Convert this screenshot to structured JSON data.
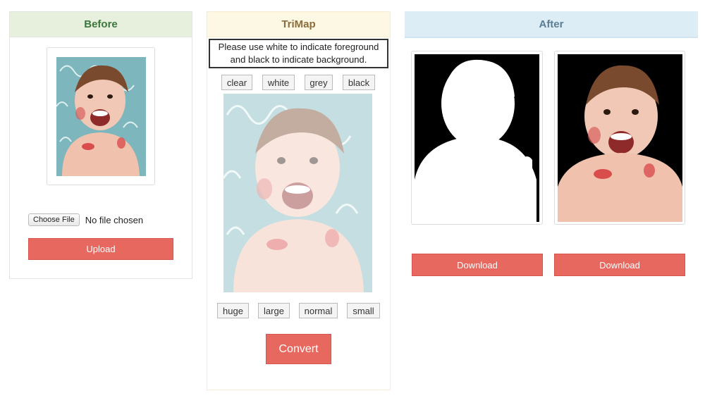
{
  "before": {
    "title": "Before",
    "choose_file_label": "Choose File",
    "file_status": "No file chosen",
    "upload_label": "Upload"
  },
  "trimap": {
    "title": "TriMap",
    "hint": "Please use white to indicate foreground and black to indicate background.",
    "colors": [
      "clear",
      "white",
      "grey",
      "black"
    ],
    "sizes": [
      "huge",
      "large",
      "normal",
      "small"
    ],
    "convert_label": "Convert"
  },
  "after": {
    "title": "After",
    "download_labels": [
      "Download",
      "Download"
    ]
  },
  "colors": {
    "accent": "#e7685f",
    "before_header": "#e6f0dd",
    "trimap_header": "#fcf8e3",
    "after_header": "#dcedf6",
    "photo_bg": "#7eb6bd"
  }
}
